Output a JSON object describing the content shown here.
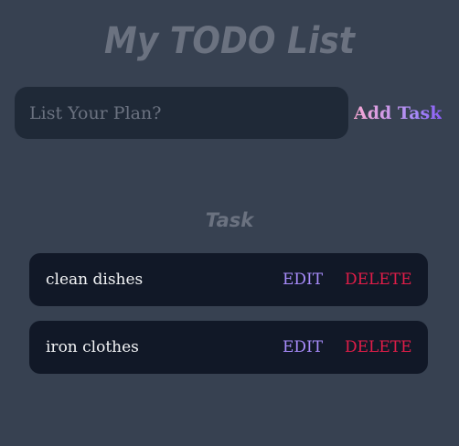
{
  "header": {
    "title": "My TODO List"
  },
  "input": {
    "placeholder": "List Your Plan?",
    "value": ""
  },
  "add_button": {
    "label": "Add Task"
  },
  "section": {
    "title": "Task"
  },
  "tasks": [
    {
      "text": "clean dishes",
      "edit_label": "EDIT",
      "delete_label": "DELETE"
    },
    {
      "text": "iron clothes",
      "edit_label": "EDIT",
      "delete_label": "DELETE"
    }
  ],
  "colors": {
    "background": "#374151",
    "input_bg": "#1f2937",
    "card_bg": "#111827",
    "muted_title": "#6b7280",
    "edit": "#a78bfa",
    "delete": "#e11d48",
    "add_gradient_start": "#f9a8d4",
    "add_gradient_end": "#8b5cf6"
  }
}
